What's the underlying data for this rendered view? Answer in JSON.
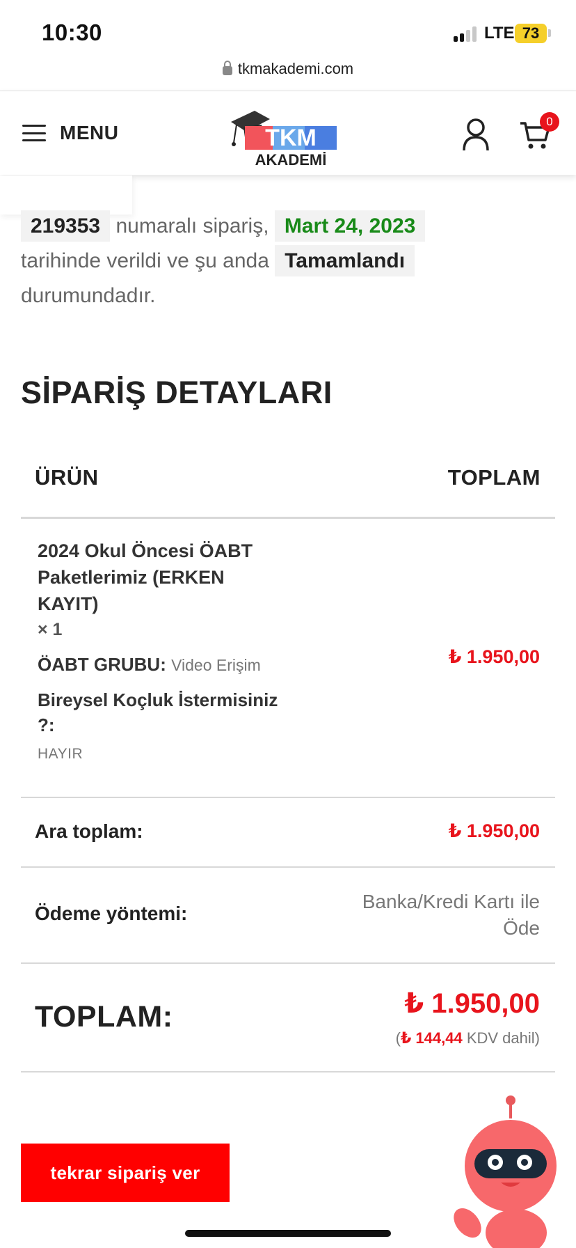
{
  "status_bar": {
    "time": "10:30",
    "network": "LTE",
    "battery": "73"
  },
  "browser": {
    "url": "tkmakademi.com"
  },
  "header": {
    "menu_label": "MENU",
    "logo": {
      "line1": "TKM",
      "line2": "AKADEMİ",
      "colors": [
        "#f2545b",
        "#5aa0e6",
        "#4a7ee0"
      ]
    },
    "cart_count": "0"
  },
  "order": {
    "number": "219353",
    "text_after_number": "numaralı sipariş,",
    "date": "Mart 24, 2023",
    "text_after_date": "tarihinde verildi ve şu anda",
    "status": "Tamamlandı",
    "text_end": "durumundadır."
  },
  "details": {
    "title": "SİPARİŞ DETAYLARI",
    "col_product": "ÜRÜN",
    "col_total": "TOPLAM",
    "product": {
      "name": "2024 Okul Öncesi ÖABT Paketlerimiz (ERKEN KAYIT)",
      "qty": "× 1",
      "meta1_label": "ÖABT GRUBU:",
      "meta1_value": "Video Erişim",
      "meta2_label": "Bireysel Koçluk İstermisiniz ?:",
      "meta2_value": "HAYIR",
      "price": "₺ 1.950,00"
    },
    "subtotal_label": "Ara toplam:",
    "subtotal_value": "₺ 1.950,00",
    "payment_label": "Ödeme yöntemi:",
    "payment_value": "Banka/Kredi Kartı ile Öde",
    "total_label": "TOPLAM:",
    "total_value": "₺ 1.950,00",
    "tax_open": "(",
    "tax_amount": "₺ 144,44",
    "tax_text": " KDV dahil)"
  },
  "actions": {
    "reorder": "tekrar sipariş ver"
  },
  "colors": {
    "accent_red": "#e8141c",
    "button_red": "#ff0000",
    "date_green": "#188a18"
  }
}
